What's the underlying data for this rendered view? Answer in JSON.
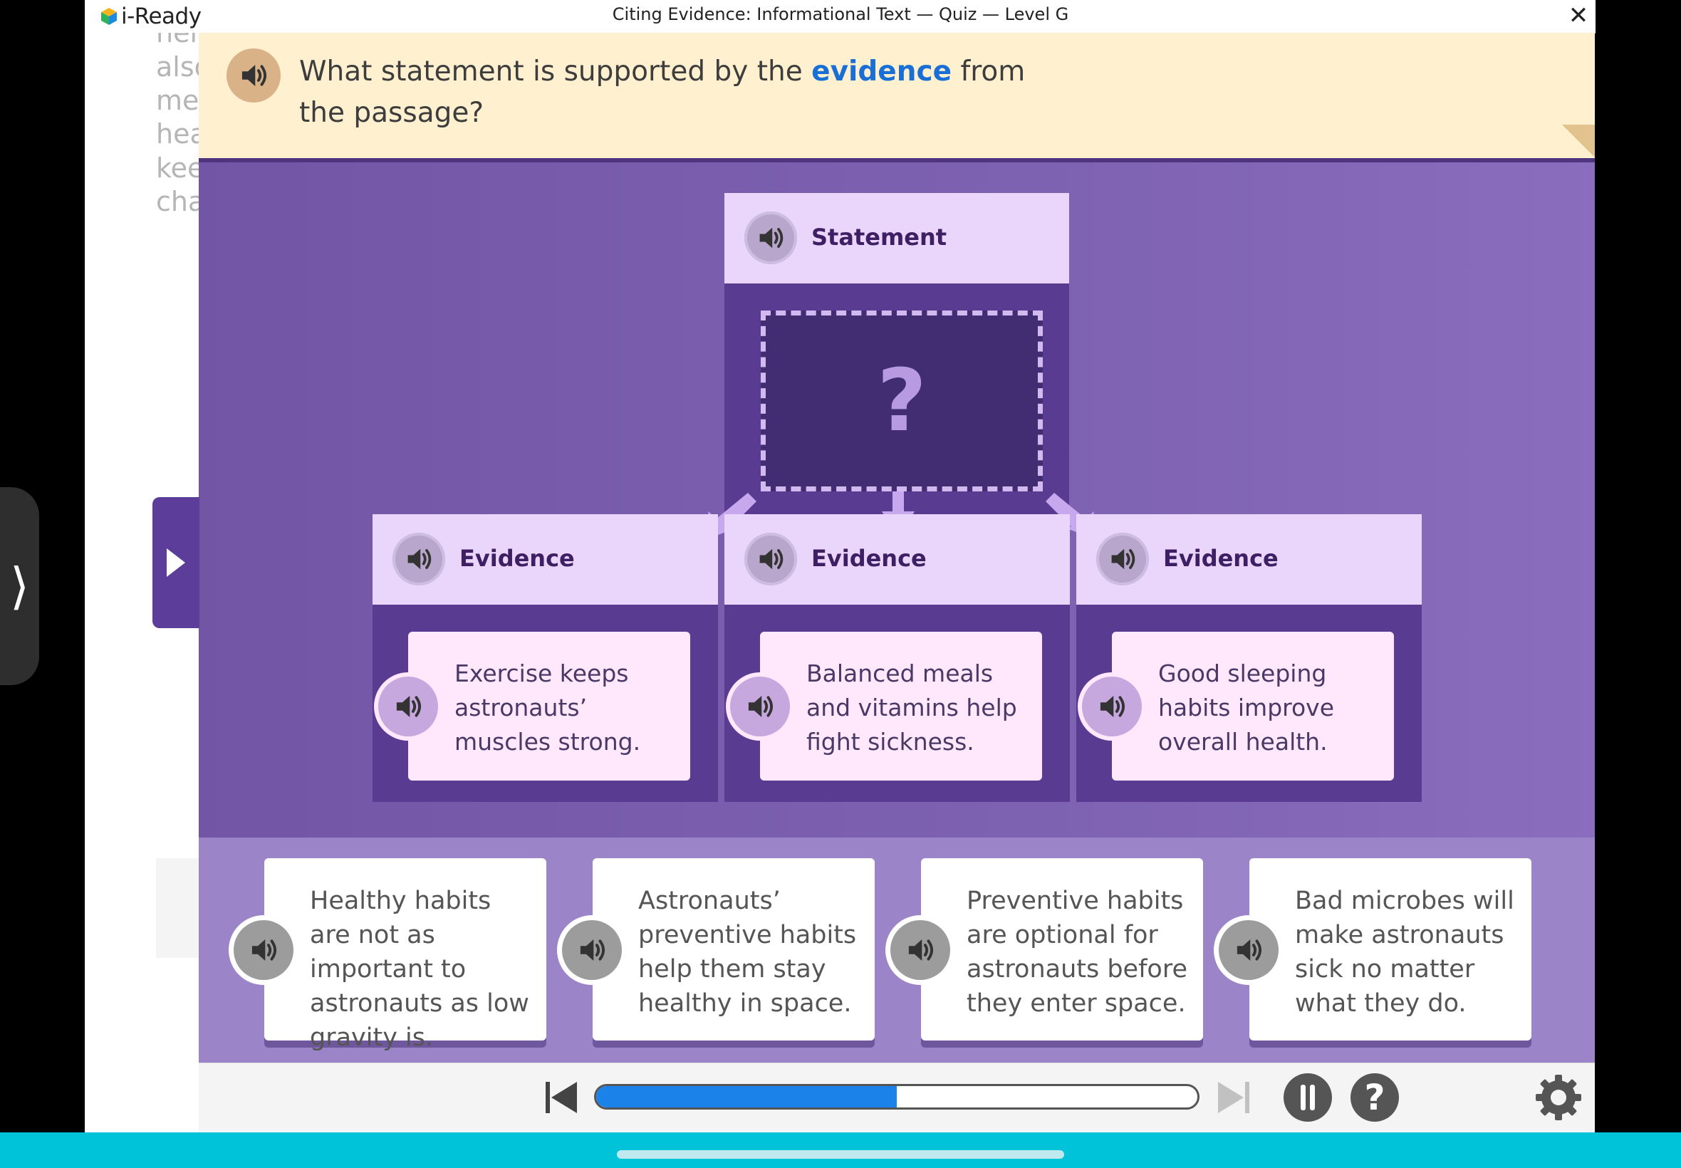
{
  "app": {
    "logo_text": "i-Ready",
    "title": "Citing Evidence: Informational Text — Quiz — Level G",
    "close_glyph": "✕"
  },
  "passage_fragments": [
    "hel",
    "also",
    "me",
    "hea",
    "kee",
    "cha"
  ],
  "question": {
    "before": "What statement is supported by the ",
    "highlight": "evidence",
    "after": " from the passage?"
  },
  "statement": {
    "label": "Statement",
    "placeholder": "?"
  },
  "evidence": [
    {
      "label": "Evidence",
      "text": "Exercise keeps astronauts’ muscles strong."
    },
    {
      "label": "Evidence",
      "text": "Balanced meals and vitamins help fight sickness."
    },
    {
      "label": "Evidence",
      "text": "Good sleeping habits improve overall health."
    }
  ],
  "answers": [
    {
      "text": "Healthy habits are not as important to astronauts as low gravity is."
    },
    {
      "text": "Astronauts’ preventive habits help them stay healthy in space."
    },
    {
      "text": "Preventive habits are optional for astronauts before they enter space."
    },
    {
      "text": "Bad microbes will make astronauts sick no matter what they do."
    }
  ],
  "controls": {
    "progress_fraction": 0.5,
    "help_glyph": "?"
  },
  "colors": {
    "highlight": "#1a6fd6",
    "stage": "#7355a5",
    "progress": "#1a82e8",
    "bottom_bar": "#00c3d9"
  },
  "icons": [
    "speaker-icon",
    "play-triangle-icon",
    "skip-back-icon",
    "skip-forward-icon",
    "pause-icon",
    "help-icon",
    "gear-icon",
    "close-icon"
  ]
}
